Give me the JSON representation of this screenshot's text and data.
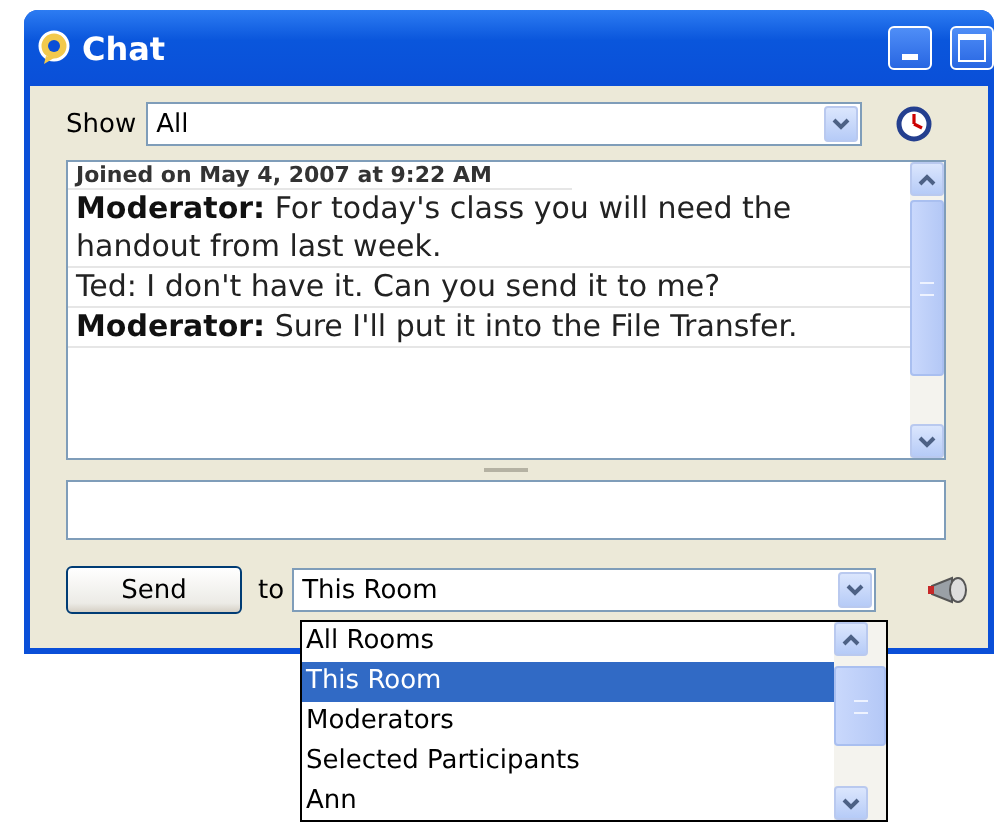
{
  "window": {
    "title": "Chat"
  },
  "filter": {
    "label": "Show",
    "value": "All"
  },
  "messages": [
    {
      "text": "Joined on May 4, 2007 at 9:22 AM",
      "kind": "clipped"
    },
    {
      "text": "**Moderator:** For today's class you will need the handout from last week.",
      "kind": "message"
    },
    {
      "text": "Ted: I don't have it.  Can you send it to me?",
      "kind": "message"
    },
    {
      "text": "**Moderator:** Sure I'll put it into the File Transfer.",
      "kind": "message"
    }
  ],
  "send_button": "Send",
  "recipient": {
    "label": "to",
    "value": "This Room"
  },
  "recipient_options": [
    {
      "label": "All Rooms",
      "selected": false
    },
    {
      "label": "This Room",
      "selected": true
    },
    {
      "label": "Moderators",
      "selected": false
    },
    {
      "label": "Selected Participants",
      "selected": false
    },
    {
      "label": "Ann",
      "selected": false
    }
  ]
}
